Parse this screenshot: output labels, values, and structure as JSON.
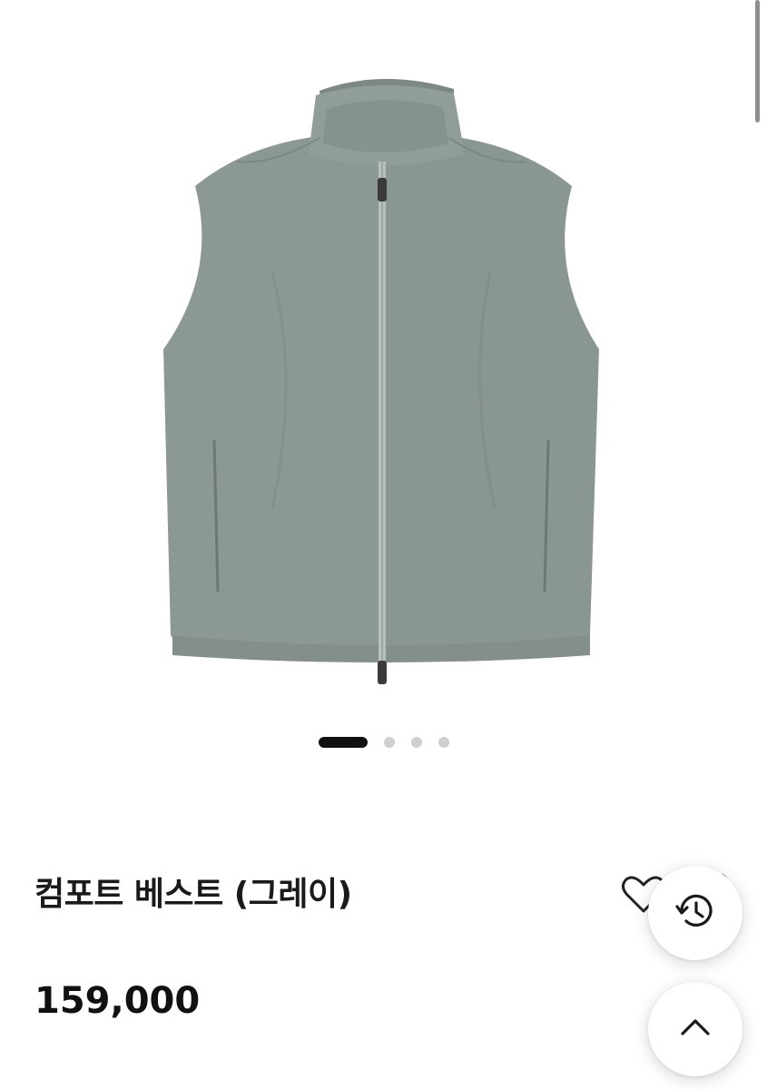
{
  "product": {
    "title": "컴포트 베스트 (그레이)",
    "price": "159,000",
    "color": "#8c9892"
  },
  "gallery": {
    "total_slides": 4,
    "active_index": 0
  },
  "actions": {
    "like_icon": "heart-icon",
    "share_icon": "share-icon",
    "history_icon": "history-icon",
    "scroll_top_icon": "chevron-up-icon"
  }
}
